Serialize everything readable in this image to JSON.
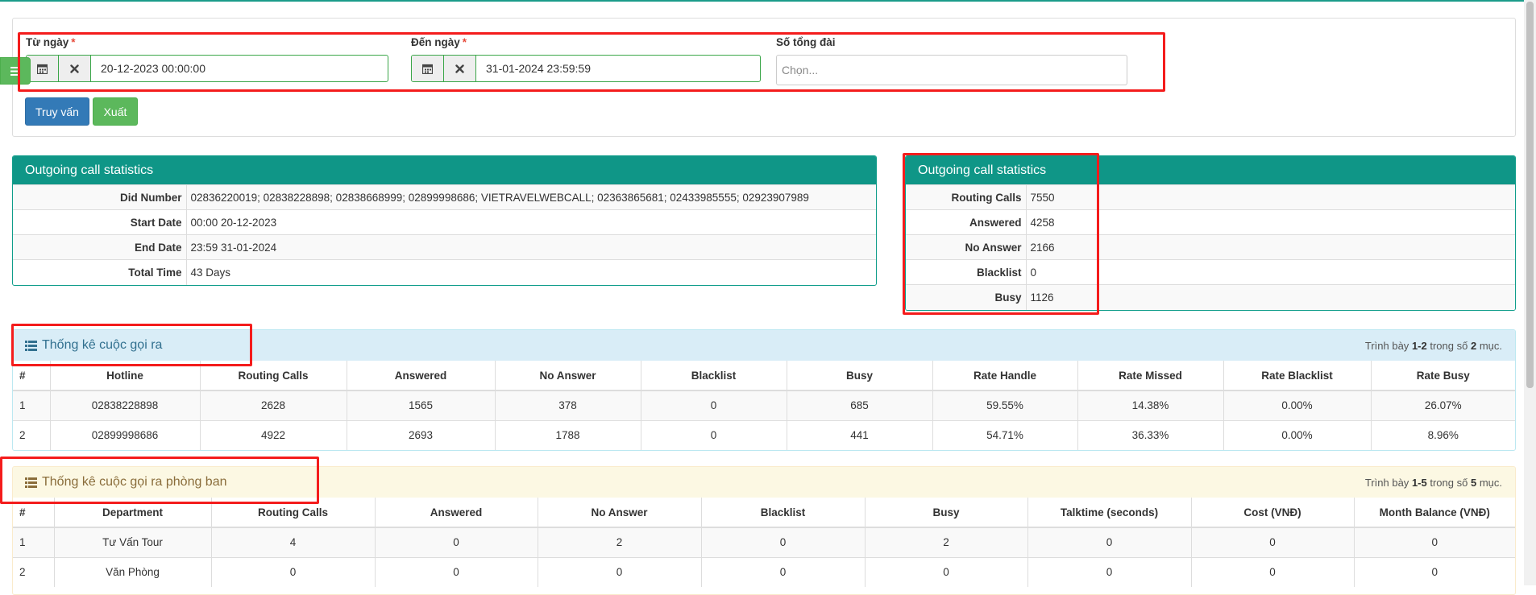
{
  "filters": {
    "from_label": "Từ ngày",
    "from_required": "*",
    "from_value": "20-12-2023 00:00:00",
    "to_label": "Đến ngày",
    "to_required": "*",
    "to_value": "31-01-2024 23:59:59",
    "switchboard_label": "Số tổng đài",
    "switchboard_placeholder": "Chọn...",
    "query_button": "Truy vấn",
    "export_button": "Xuất",
    "sidebar_toggle": "☰"
  },
  "info_panel": {
    "title": "Outgoing call statistics",
    "rows": [
      {
        "key": "Did Number",
        "value": "02836220019; 02838228898; 02838668999; 02899998686; VIETRAVELWEBCALL; 02363865681; 02433985555; 02923907989"
      },
      {
        "key": "Start Date",
        "value": "00:00 20-12-2023"
      },
      {
        "key": "End Date",
        "value": "23:59 31-01-2024"
      },
      {
        "key": "Total Time",
        "value": "43 Days"
      }
    ]
  },
  "summary_panel": {
    "title": "Outgoing call statistics",
    "rows": [
      {
        "key": "Routing Calls",
        "value": "7550"
      },
      {
        "key": "Answered",
        "value": "4258"
      },
      {
        "key": "No Answer",
        "value": "2166"
      },
      {
        "key": "Blacklist",
        "value": "0"
      },
      {
        "key": "Busy",
        "value": "1126"
      }
    ]
  },
  "outgoing_list": {
    "title": "Thống kê cuộc gọi ra",
    "summary_prefix": "Trình bày",
    "summary_range": "1-2",
    "summary_middle": "trong số",
    "summary_total": "2",
    "summary_suffix": "mục.",
    "columns": [
      "#",
      "Hotline",
      "Routing Calls",
      "Answered",
      "No Answer",
      "Blacklist",
      "Busy",
      "Rate Handle",
      "Rate Missed",
      "Rate Blacklist",
      "Rate Busy"
    ],
    "rows": [
      [
        "1",
        "02838228898",
        "2628",
        "1565",
        "378",
        "0",
        "685",
        "59.55%",
        "14.38%",
        "0.00%",
        "26.07%"
      ],
      [
        "2",
        "02899998686",
        "4922",
        "2693",
        "1788",
        "0",
        "441",
        "54.71%",
        "36.33%",
        "0.00%",
        "8.96%"
      ]
    ]
  },
  "department_list": {
    "title": "Thống kê cuộc gọi ra phòng ban",
    "summary_prefix": "Trình bày",
    "summary_range": "1-5",
    "summary_middle": "trong số",
    "summary_total": "5",
    "summary_suffix": "mục.",
    "columns": [
      "#",
      "Department",
      "Routing Calls",
      "Answered",
      "No Answer",
      "Blacklist",
      "Busy",
      "Talktime (seconds)",
      "Cost (VNĐ)",
      "Month Balance (VNĐ)"
    ],
    "rows": [
      [
        "1",
        "Tư Vấn Tour",
        "4",
        "0",
        "2",
        "0",
        "2",
        "0",
        "0",
        "0"
      ],
      [
        "2",
        "Văn Phòng",
        "0",
        "0",
        "0",
        "0",
        "0",
        "0",
        "0",
        "0"
      ]
    ]
  },
  "colors": {
    "panel_header": "#0f9687",
    "primary": "#337ab7",
    "success": "#5cb85c",
    "highlight": "#f41c1c",
    "info_bg": "#d9edf7",
    "warning_bg": "#fcf8e3"
  },
  "icons": {
    "calendar": "calendar-icon",
    "clear": "close-icon",
    "list": "list-icon",
    "menu": "menu-icon"
  }
}
